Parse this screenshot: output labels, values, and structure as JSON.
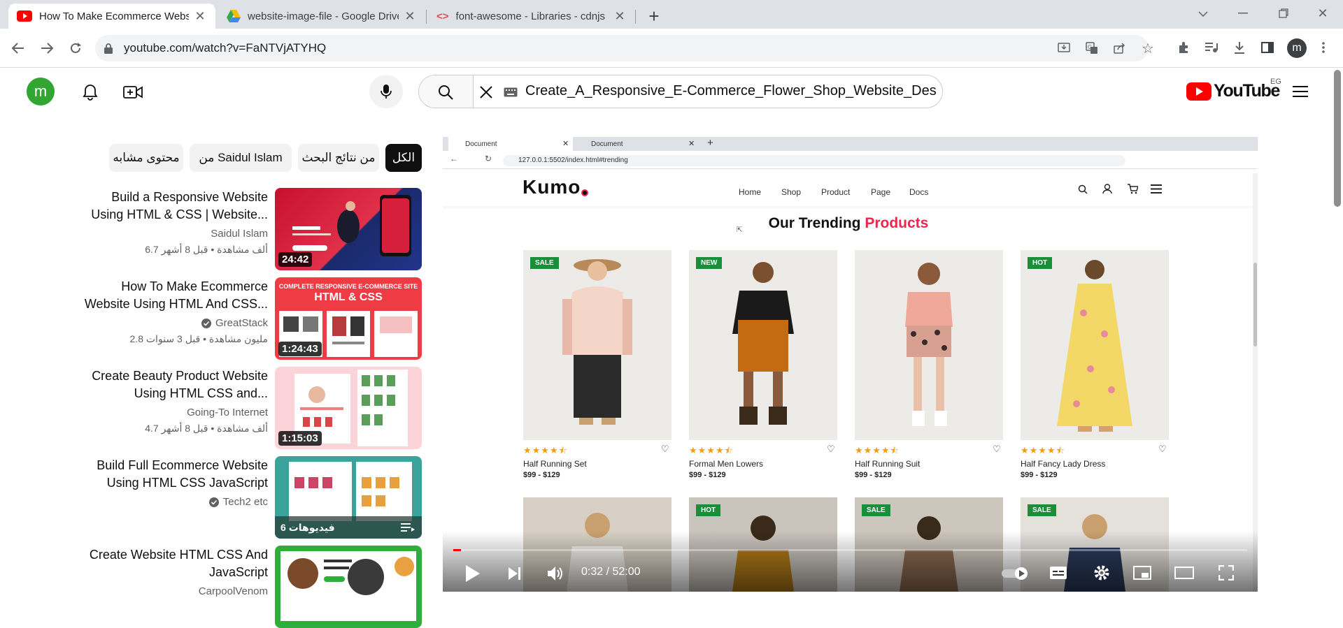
{
  "browser": {
    "tabs": [
      {
        "title": "How To Make Ecommerce Website",
        "icon": "youtube-icon",
        "active": true
      },
      {
        "title": "website-image-file - Google Drive",
        "icon": "google-drive-icon",
        "active": false
      },
      {
        "title": "font-awesome - Libraries - cdnjs",
        "icon": "cdnjs-icon",
        "active": false
      }
    ],
    "url": "youtube.com/watch?v=FaNTVjATYHQ"
  },
  "youtube": {
    "avatar_letter": "m",
    "search_query": "Create_A_Responsive_E-Commerce_Flower_Shop_Website_Desig",
    "logo_text": "YouTube",
    "region": "EG",
    "chips": [
      "الكل",
      "من نتائج البحث",
      "من Saidul Islam",
      "محتوى مشابه"
    ],
    "related": [
      {
        "title_line1": "Build a Responsive Website",
        "title_line2": "Using HTML & CSS | Website...",
        "channel": "Saidul Islam",
        "meta": "6.7 ألف مشاهدة  •  قبل 8 أشهر",
        "duration": "24:42",
        "verified": false
      },
      {
        "title_line1": "How To Make Ecommerce",
        "title_line2": "Website Using HTML And CSS...",
        "channel": "GreatStack",
        "meta": "2.8 مليون مشاهدة  •  قبل 3 سنوات",
        "duration": "1:24:43",
        "verified": true,
        "thumb_heading": "COMPLETE RESPONSIVE E-COMMERCE SITE",
        "thumb_sub": "HTML & CSS"
      },
      {
        "title_line1": "Create Beauty Product Website",
        "title_line2": "Using HTML CSS and...",
        "channel": "Going-To Internet",
        "meta": "4.7 ألف مشاهدة  •  قبل 8 أشهر",
        "duration": "1:15:03",
        "verified": false
      },
      {
        "title_line1": "Build Full Ecommerce Website",
        "title_line2": "Using HTML CSS JavaScript",
        "channel": "Tech2 etc",
        "meta": "",
        "duration": "",
        "verified": true,
        "playlist": "6 فيديوهات"
      },
      {
        "title_line1": "Create Website HTML CSS And",
        "title_line2": "JavaScript",
        "channel": "CarpoolVenom",
        "meta": "",
        "duration": "",
        "verified": false
      }
    ]
  },
  "video": {
    "inner_tabs": [
      "Document",
      "Document"
    ],
    "inner_url": "127.0.0.1:5502/index.html#trending",
    "site_logo": "Kumo",
    "nav": [
      "Home",
      "Shop",
      "Product",
      "Page",
      "Docs"
    ],
    "section_title_a": "Our Trending",
    "section_title_b": "Products",
    "products": [
      {
        "name": "Half Running Set",
        "price": "$99 - $129",
        "badge": "SALE",
        "badge_color": "#1a8f3a",
        "rating": 4.5
      },
      {
        "name": "Formal Men Lowers",
        "price": "$99 - $129",
        "badge": "NEW",
        "badge_color": "#1a8f3a",
        "rating": 4.5
      },
      {
        "name": "Half Running Suit",
        "price": "$99 - $129",
        "badge": "",
        "badge_color": "",
        "rating": 4.5
      },
      {
        "name": "Half Fancy Lady Dress",
        "price": "$99 - $129",
        "badge": "HOT",
        "badge_color": "#1a8f3a",
        "rating": 4.5
      }
    ],
    "row2_badges": [
      "",
      "HOT",
      "SALE",
      "SALE"
    ],
    "time_current": "0:32",
    "time_total": "52:00",
    "progress": 0.01
  }
}
